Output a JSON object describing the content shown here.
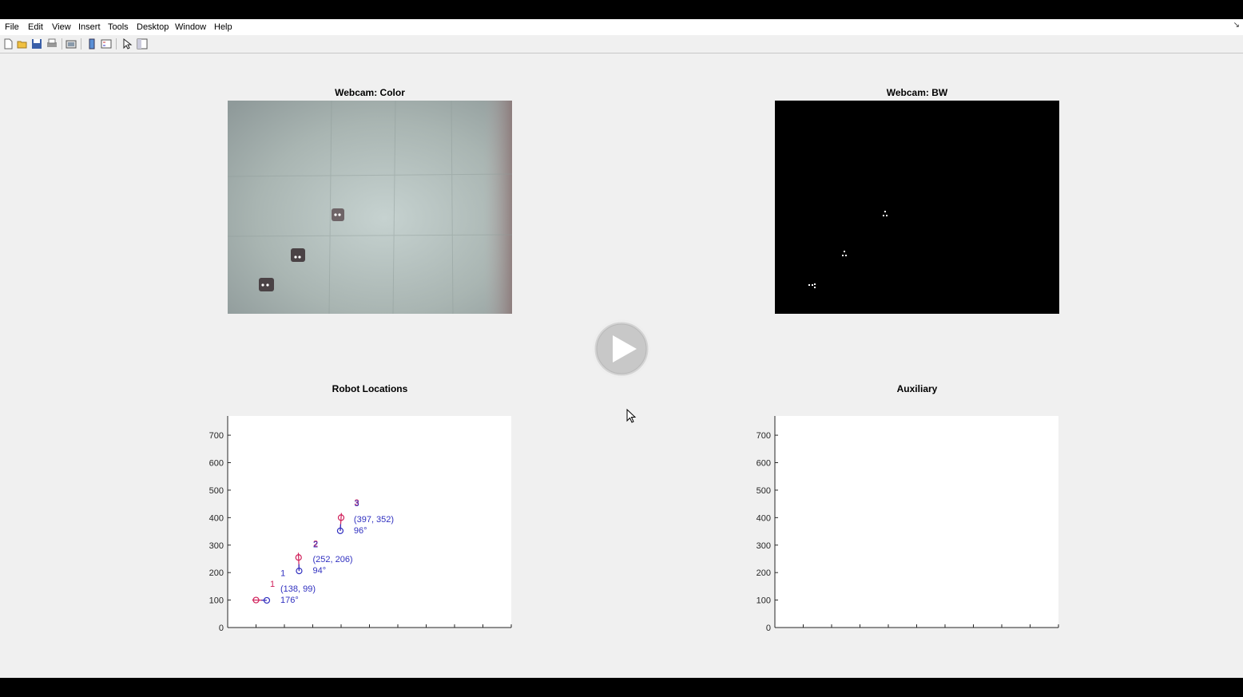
{
  "menu": {
    "items": [
      "File",
      "Edit",
      "View",
      "Insert",
      "Tools",
      "Desktop",
      "Window",
      "Help"
    ]
  },
  "toolbar": {
    "icons": [
      "new-figure-icon",
      "open-file-icon",
      "save-icon",
      "print-icon",
      "print-preview-icon",
      "insert-colorbar-icon",
      "insert-legend-icon",
      "pointer-icon",
      "property-editor-icon"
    ]
  },
  "panels": {
    "color": {
      "title": "Webcam: Color"
    },
    "bw": {
      "title": "Webcam: BW"
    },
    "robots": {
      "title": "Robot Locations"
    },
    "aux": {
      "title": "Auxiliary"
    }
  },
  "play_button": {
    "icon": "play-icon"
  },
  "chart_data": [
    {
      "type": "scatter",
      "title": "Robot Locations",
      "xlabel": "",
      "ylabel": "",
      "xlim": [
        0,
        1000
      ],
      "ylim": [
        0,
        770
      ],
      "xticks": [
        0,
        100,
        200,
        300,
        400,
        500,
        600,
        700,
        800,
        900,
        1000
      ],
      "yticks": [
        0,
        100,
        200,
        300,
        400,
        500,
        600,
        700
      ],
      "grid": false,
      "colors": {
        "red": "#d0205a",
        "blue": "#3030c0"
      },
      "robots": [
        {
          "id_blue": "1",
          "id_red": "1",
          "coords": "(138, 99)",
          "angle": "176°",
          "red": {
            "x": 100,
            "y": 100
          },
          "blue": {
            "x": 138,
            "y": 99
          },
          "blue_id_pos": {
            "x": 195,
            "y": 188
          },
          "red_id_pos": {
            "x": 158,
            "y": 148
          }
        },
        {
          "id_blue": "2",
          "id_red": "2",
          "coords": "(252, 206)",
          "angle": "94°",
          "red": {
            "x": 250,
            "y": 255
          },
          "blue": {
            "x": 252,
            "y": 206
          },
          "blue_id_pos": {
            "x": 310,
            "y": 292
          },
          "red_id_pos": {
            "x": 310,
            "y": 295
          }
        },
        {
          "id_blue": "3",
          "id_red": "3",
          "coords": "(397, 352)",
          "angle": "96°",
          "red": {
            "x": 400,
            "y": 400
          },
          "blue": {
            "x": 397,
            "y": 352
          },
          "blue_id_pos": {
            "x": 455,
            "y": 442
          },
          "red_id_pos": {
            "x": 455,
            "y": 445
          }
        }
      ]
    },
    {
      "type": "scatter",
      "title": "Auxiliary",
      "xlabel": "",
      "ylabel": "",
      "xlim": [
        0,
        1000
      ],
      "ylim": [
        0,
        770
      ],
      "xticks": [
        0,
        100,
        200,
        300,
        400,
        500,
        600,
        700,
        800,
        900,
        1000
      ],
      "yticks": [
        0,
        100,
        200,
        300,
        400,
        500,
        600,
        700
      ],
      "grid": false,
      "series": []
    }
  ]
}
